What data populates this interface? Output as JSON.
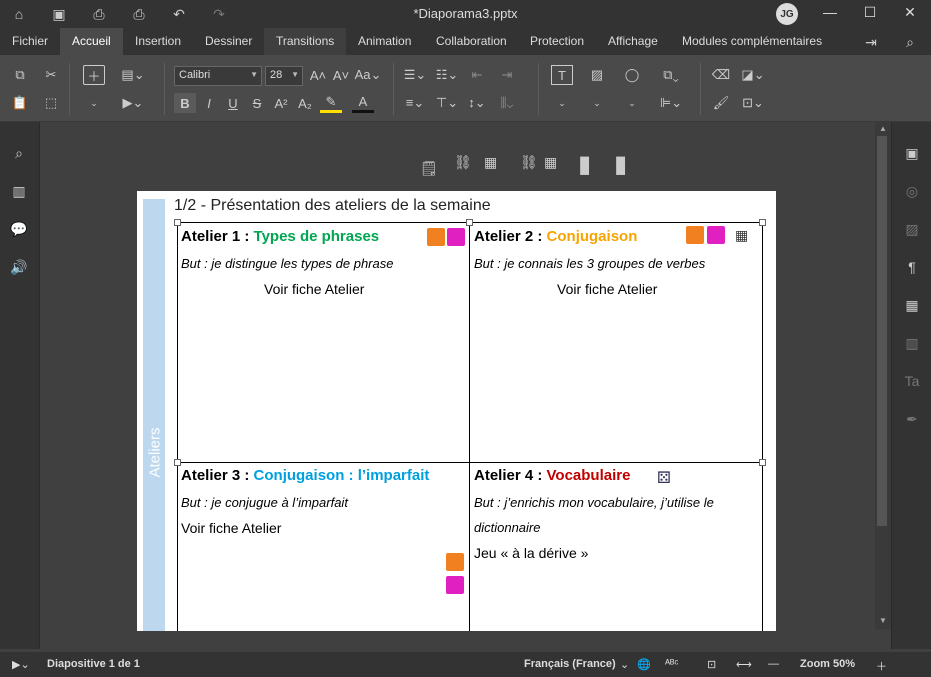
{
  "window": {
    "title": "*Diaporama3.pptx",
    "user_initials": "JG"
  },
  "menu": {
    "items": [
      "Fichier",
      "Accueil",
      "Insertion",
      "Dessiner",
      "Transitions",
      "Animation",
      "Collaboration",
      "Protection",
      "Affichage",
      "Modules complémentaires"
    ],
    "active": "Accueil"
  },
  "toolbar": {
    "font_name": "Calibri",
    "font_size": "28",
    "style_preview": "Aa"
  },
  "slide": {
    "title": "1/2 - Présentation des ateliers de la semaine",
    "band_label": "Ateliers",
    "cells": [
      {
        "title_prefix": "Atelier 1 : ",
        "title_colored": "Types de phrases",
        "color": "#00a651",
        "goal": "But : je distingue les types de phrase",
        "link": "Voir fiche Atelier"
      },
      {
        "title_prefix": "Atelier 2 : ",
        "title_colored": "Conjugaison",
        "color": "#f7a400",
        "goal": "But : je connais les 3 groupes de verbes",
        "link": "Voir fiche Atelier"
      },
      {
        "title_prefix": "Atelier 3 : ",
        "title_colored": "Conjugaison : l’imparfait",
        "color": "#00a0e0",
        "goal": "But : je conjugue à l’imparfait",
        "link": "Voir fiche Atelier"
      },
      {
        "title_prefix": "Atelier 4 : ",
        "title_colored": "Vocabulaire",
        "color": "#c00000",
        "goal_line1": "But : j’enrichis mon vocabulaire, j’utilise le",
        "goal_line2": "dictionnaire",
        "link": "Jeu « à la dérive »"
      }
    ]
  },
  "status": {
    "slide_info": "Diapositive 1 de 1",
    "language": "Français (France)",
    "zoom": "Zoom 50%"
  },
  "colors": {
    "orange_icon": "#f08020",
    "magenta_icon": "#e020c0"
  }
}
